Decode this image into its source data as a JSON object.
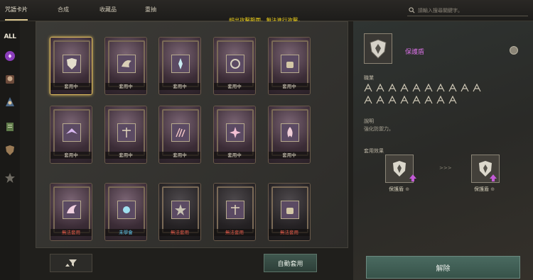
{
  "nav": {
    "tabs": [
      {
        "label": "咒語卡片"
      },
      {
        "label": "合成"
      },
      {
        "label": "收藏品"
      },
      {
        "label": "重抽"
      }
    ],
    "search_placeholder": "請輸入搜尋關鍵字。"
  },
  "warning": "超出攻擊範圍。無法進行攻擊。",
  "rail": {
    "all_label": "ALL",
    "categories": [
      "purple-rune-icon",
      "skull-icon",
      "wizard-icon",
      "scroll-icon",
      "shield-icon",
      "star-icon"
    ]
  },
  "cards": [
    {
      "status": "套用中",
      "status_color": "#e4ddcb",
      "emblem": "shield-icon",
      "selected": true,
      "dim": false
    },
    {
      "status": "套用中",
      "status_color": "#e4ddcb",
      "emblem": "dragon-icon",
      "selected": false,
      "dim": false
    },
    {
      "status": "套用中",
      "status_color": "#e4ddcb",
      "emblem": "ice-icon",
      "selected": false,
      "dim": false
    },
    {
      "status": "套用中",
      "status_color": "#e4ddcb",
      "emblem": "swirl-icon",
      "selected": false,
      "dim": false
    },
    {
      "status": "套用中",
      "status_color": "#e4ddcb",
      "emblem": "bag-icon",
      "selected": false,
      "dim": false
    },
    {
      "status": "套用中",
      "status_color": "#e4ddcb",
      "emblem": "bird-icon",
      "selected": false,
      "dim": false
    },
    {
      "status": "套用中",
      "status_color": "#e4ddcb",
      "emblem": "scales-icon",
      "selected": false,
      "dim": false
    },
    {
      "status": "套用中",
      "status_color": "#e4ddcb",
      "emblem": "claw-icon",
      "selected": false,
      "dim": false
    },
    {
      "status": "套用中",
      "status_color": "#e4ddcb",
      "emblem": "burst-icon",
      "selected": false,
      "dim": false
    },
    {
      "status": "套用中",
      "status_color": "#e4ddcb",
      "emblem": "flame-icon",
      "selected": false,
      "dim": false
    },
    {
      "status": "無法套用",
      "status_color": "#e45a4a",
      "emblem": "wing-icon",
      "selected": false,
      "dim": false
    },
    {
      "status": "未學會",
      "status_color": "#5fc8ef",
      "emblem": "orb-icon",
      "selected": false,
      "dim": false
    },
    {
      "status": "無法套用",
      "status_color": "#e45a4a",
      "emblem": "star-icon",
      "selected": false,
      "dim": true
    },
    {
      "status": "無法套用",
      "status_color": "#e45a4a",
      "emblem": "scales-icon",
      "selected": false,
      "dim": true
    },
    {
      "status": "無法套用",
      "status_color": "#e45a4a",
      "emblem": "bag-icon",
      "selected": false,
      "dim": true
    }
  ],
  "buttons": {
    "auto_apply": "自動套用",
    "release": "解除"
  },
  "detail": {
    "title": "保護盾",
    "class_label": "職業",
    "class_icons": 18,
    "desc_label": "說明",
    "desc_text": "強化防禦力。",
    "effect_label": "套用效果",
    "effect_from": "保護盾",
    "effect_to": "保護盾",
    "arrows": ">>>"
  },
  "colors": {
    "accent_gold": "#e0bd5f",
    "warning_yellow": "#f0d21c",
    "title_purple": "#d46fe0",
    "status_red": "#e45a4a",
    "status_cyan": "#5fc8ef"
  }
}
